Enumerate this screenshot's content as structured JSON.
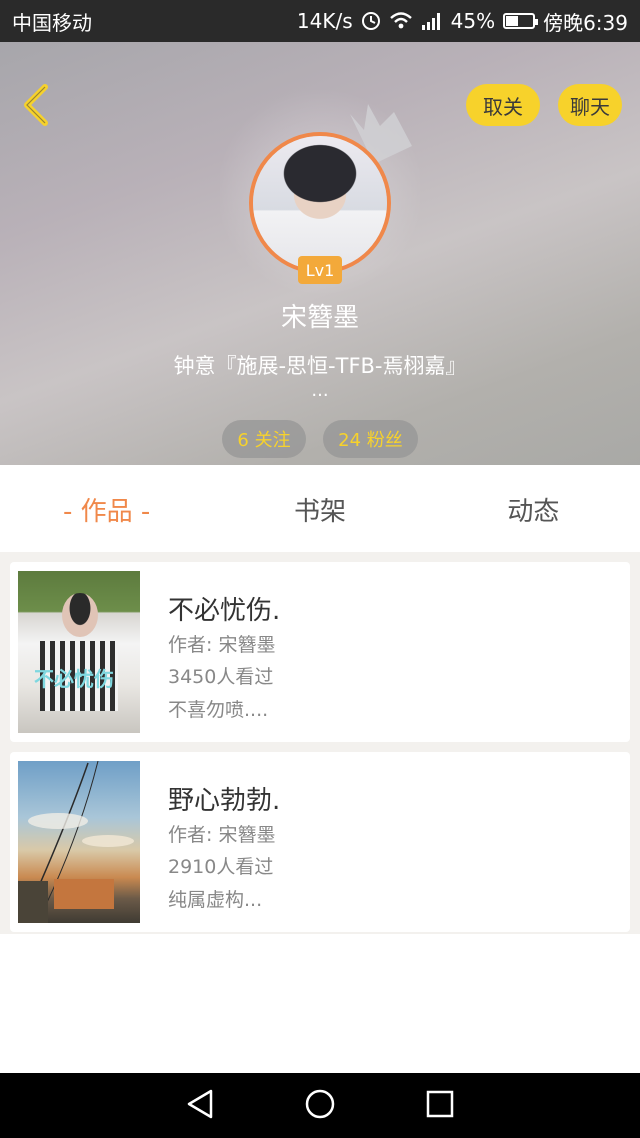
{
  "status_bar": {
    "carrier": "中国移动",
    "net_speed": "14K/s",
    "battery_pct": "45%",
    "battery_level": 0.45,
    "time": "傍晚6:39"
  },
  "header": {
    "unfollow_label": "取关",
    "chat_label": "聊天",
    "level": "Lv1",
    "username": "宋簪墨",
    "bio": "钟意『施展-思恒-TFB-焉栩嘉』",
    "bio_more": "...",
    "following": "6 关注",
    "followers": "24 粉丝"
  },
  "tabs": [
    {
      "label": "- 作品 -",
      "active": true
    },
    {
      "label": "书架",
      "active": false
    },
    {
      "label": "动态",
      "active": false
    }
  ],
  "works": [
    {
      "title": "不必忧伤.",
      "author": "作者: 宋簪墨",
      "views": "3450人看过",
      "desc": "不喜勿喷....",
      "cover_text": "不必忧伤"
    },
    {
      "title": "野心勃勃.",
      "author": "作者: 宋簪墨",
      "views": "2910人看过",
      "desc": "纯属虚构..."
    }
  ],
  "colors": {
    "accent_yellow": "#f7d22b",
    "accent_orange": "#f0884a"
  }
}
